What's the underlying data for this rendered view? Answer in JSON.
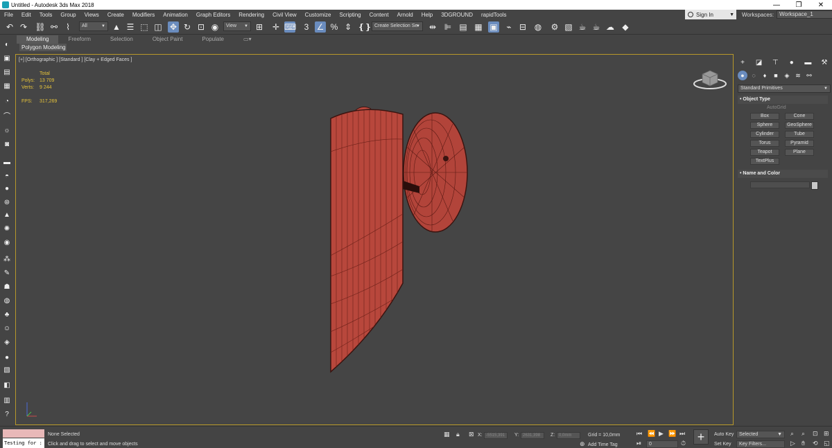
{
  "titlebar": {
    "title": "Untitled - Autodesk 3ds Max 2018",
    "minimize": "—",
    "maximize": "❐",
    "close": "✕"
  },
  "menu": [
    "File",
    "Edit",
    "Tools",
    "Group",
    "Views",
    "Create",
    "Modifiers",
    "Animation",
    "Graph Editors",
    "Rendering",
    "Civil View",
    "Customize",
    "Scripting",
    "Content",
    "Arnold",
    "Help",
    "3DGROUND",
    "rapidTools"
  ],
  "signin": {
    "label": "Sign In",
    "caret": "▼"
  },
  "workspaces": {
    "label": "Workspaces:",
    "value": "Workspace_1"
  },
  "toolbar": {
    "filter": "All",
    "refcoord": "View",
    "selection_set": "Create Selection Se",
    "caret": "▼"
  },
  "ribbon": {
    "tabs": [
      "Modeling",
      "Freeform",
      "Selection",
      "Object Paint",
      "Populate"
    ],
    "sub": "Polygon Modeling"
  },
  "viewport": {
    "label": "[+] [Orthographic ] [Standard ] [Clay + Edged Faces ]",
    "stats": {
      "total": "Total",
      "polys_label": "Polys:",
      "polys": "13 709",
      "verts_label": "Verts:",
      "verts": "9 244",
      "fps_label": "FPS:",
      "fps": "317,269"
    }
  },
  "cmdpanel": {
    "dropdown": "Standard Primitives",
    "object_type": "Object Type",
    "autogrid": "AutoGrid",
    "primitives": [
      "Box",
      "Cone",
      "Sphere",
      "GeoSphere",
      "Cylinder",
      "Tube",
      "Torus",
      "Pyramid",
      "Teapot",
      "Plane",
      "TextPlus"
    ],
    "name_and_color": "Name and Color"
  },
  "status": {
    "selection": "None Selected",
    "prompt": "Click and drag to select and move objects",
    "maxscript": "Testing for :",
    "x_label": "X:",
    "x_value": "-5515,391",
    "y_label": "Y:",
    "y_value": "2631,398",
    "z_label": "Z:",
    "z_value": "0,0mm",
    "grid": "Grid = 10,0mm",
    "add_time_tag": "Add Time Tag",
    "auto_key": "Auto Key",
    "set_key": "Set Key",
    "selected": "Selected",
    "key_filters": "Key Filters...",
    "frame": "0"
  }
}
